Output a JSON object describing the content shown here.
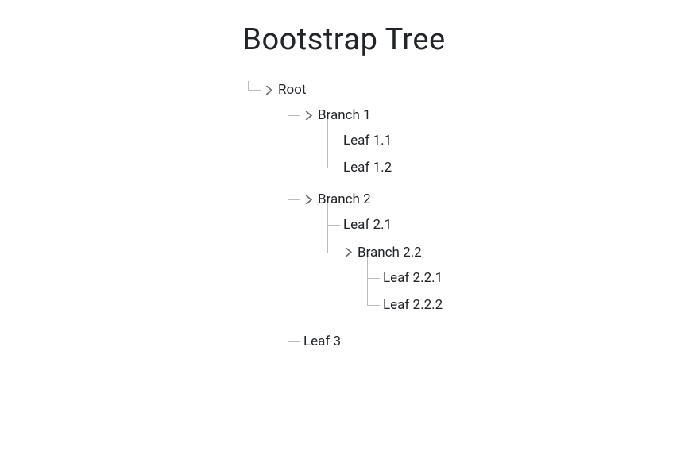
{
  "title": "Bootstrap Tree",
  "tree": {
    "root": {
      "label": "Root",
      "expandable": true,
      "children": {
        "branch1": {
          "label": "Branch 1",
          "expandable": true,
          "children": {
            "leaf1_1": {
              "label": "Leaf 1.1"
            },
            "leaf1_2": {
              "label": "Leaf 1.2"
            }
          }
        },
        "branch2": {
          "label": "Branch 2",
          "expandable": true,
          "children": {
            "leaf2_1": {
              "label": "Leaf 2.1"
            },
            "branch2_2": {
              "label": "Branch 2.2",
              "expandable": true,
              "children": {
                "leaf2_2_1": {
                  "label": "Leaf 2.2.1"
                },
                "leaf2_2_2": {
                  "label": "Leaf 2.2.2"
                }
              }
            }
          }
        },
        "leaf3": {
          "label": "Leaf 3"
        }
      }
    }
  }
}
